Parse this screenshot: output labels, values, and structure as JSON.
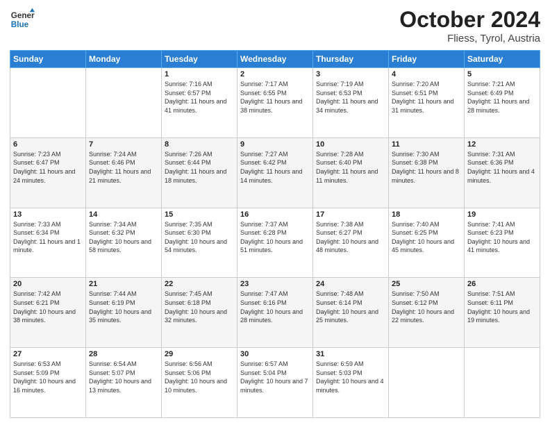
{
  "header": {
    "logo": {
      "general": "General",
      "blue": "Blue"
    },
    "title": "October 2024",
    "location": "Fliess, Tyrol, Austria"
  },
  "days": [
    "Sunday",
    "Monday",
    "Tuesday",
    "Wednesday",
    "Thursday",
    "Friday",
    "Saturday"
  ],
  "weeks": [
    [
      null,
      null,
      {
        "day": "1",
        "sunrise": "Sunrise: 7:16 AM",
        "sunset": "Sunset: 6:57 PM",
        "daylight": "Daylight: 11 hours and 41 minutes."
      },
      {
        "day": "2",
        "sunrise": "Sunrise: 7:17 AM",
        "sunset": "Sunset: 6:55 PM",
        "daylight": "Daylight: 11 hours and 38 minutes."
      },
      {
        "day": "3",
        "sunrise": "Sunrise: 7:19 AM",
        "sunset": "Sunset: 6:53 PM",
        "daylight": "Daylight: 11 hours and 34 minutes."
      },
      {
        "day": "4",
        "sunrise": "Sunrise: 7:20 AM",
        "sunset": "Sunset: 6:51 PM",
        "daylight": "Daylight: 11 hours and 31 minutes."
      },
      {
        "day": "5",
        "sunrise": "Sunrise: 7:21 AM",
        "sunset": "Sunset: 6:49 PM",
        "daylight": "Daylight: 11 hours and 28 minutes."
      }
    ],
    [
      {
        "day": "6",
        "sunrise": "Sunrise: 7:23 AM",
        "sunset": "Sunset: 6:47 PM",
        "daylight": "Daylight: 11 hours and 24 minutes."
      },
      {
        "day": "7",
        "sunrise": "Sunrise: 7:24 AM",
        "sunset": "Sunset: 6:46 PM",
        "daylight": "Daylight: 11 hours and 21 minutes."
      },
      {
        "day": "8",
        "sunrise": "Sunrise: 7:26 AM",
        "sunset": "Sunset: 6:44 PM",
        "daylight": "Daylight: 11 hours and 18 minutes."
      },
      {
        "day": "9",
        "sunrise": "Sunrise: 7:27 AM",
        "sunset": "Sunset: 6:42 PM",
        "daylight": "Daylight: 11 hours and 14 minutes."
      },
      {
        "day": "10",
        "sunrise": "Sunrise: 7:28 AM",
        "sunset": "Sunset: 6:40 PM",
        "daylight": "Daylight: 11 hours and 11 minutes."
      },
      {
        "day": "11",
        "sunrise": "Sunrise: 7:30 AM",
        "sunset": "Sunset: 6:38 PM",
        "daylight": "Daylight: 11 hours and 8 minutes."
      },
      {
        "day": "12",
        "sunrise": "Sunrise: 7:31 AM",
        "sunset": "Sunset: 6:36 PM",
        "daylight": "Daylight: 11 hours and 4 minutes."
      }
    ],
    [
      {
        "day": "13",
        "sunrise": "Sunrise: 7:33 AM",
        "sunset": "Sunset: 6:34 PM",
        "daylight": "Daylight: 11 hours and 1 minute."
      },
      {
        "day": "14",
        "sunrise": "Sunrise: 7:34 AM",
        "sunset": "Sunset: 6:32 PM",
        "daylight": "Daylight: 10 hours and 58 minutes."
      },
      {
        "day": "15",
        "sunrise": "Sunrise: 7:35 AM",
        "sunset": "Sunset: 6:30 PM",
        "daylight": "Daylight: 10 hours and 54 minutes."
      },
      {
        "day": "16",
        "sunrise": "Sunrise: 7:37 AM",
        "sunset": "Sunset: 6:28 PM",
        "daylight": "Daylight: 10 hours and 51 minutes."
      },
      {
        "day": "17",
        "sunrise": "Sunrise: 7:38 AM",
        "sunset": "Sunset: 6:27 PM",
        "daylight": "Daylight: 10 hours and 48 minutes."
      },
      {
        "day": "18",
        "sunrise": "Sunrise: 7:40 AM",
        "sunset": "Sunset: 6:25 PM",
        "daylight": "Daylight: 10 hours and 45 minutes."
      },
      {
        "day": "19",
        "sunrise": "Sunrise: 7:41 AM",
        "sunset": "Sunset: 6:23 PM",
        "daylight": "Daylight: 10 hours and 41 minutes."
      }
    ],
    [
      {
        "day": "20",
        "sunrise": "Sunrise: 7:42 AM",
        "sunset": "Sunset: 6:21 PM",
        "daylight": "Daylight: 10 hours and 38 minutes."
      },
      {
        "day": "21",
        "sunrise": "Sunrise: 7:44 AM",
        "sunset": "Sunset: 6:19 PM",
        "daylight": "Daylight: 10 hours and 35 minutes."
      },
      {
        "day": "22",
        "sunrise": "Sunrise: 7:45 AM",
        "sunset": "Sunset: 6:18 PM",
        "daylight": "Daylight: 10 hours and 32 minutes."
      },
      {
        "day": "23",
        "sunrise": "Sunrise: 7:47 AM",
        "sunset": "Sunset: 6:16 PM",
        "daylight": "Daylight: 10 hours and 28 minutes."
      },
      {
        "day": "24",
        "sunrise": "Sunrise: 7:48 AM",
        "sunset": "Sunset: 6:14 PM",
        "daylight": "Daylight: 10 hours and 25 minutes."
      },
      {
        "day": "25",
        "sunrise": "Sunrise: 7:50 AM",
        "sunset": "Sunset: 6:12 PM",
        "daylight": "Daylight: 10 hours and 22 minutes."
      },
      {
        "day": "26",
        "sunrise": "Sunrise: 7:51 AM",
        "sunset": "Sunset: 6:11 PM",
        "daylight": "Daylight: 10 hours and 19 minutes."
      }
    ],
    [
      {
        "day": "27",
        "sunrise": "Sunrise: 6:53 AM",
        "sunset": "Sunset: 5:09 PM",
        "daylight": "Daylight: 10 hours and 16 minutes."
      },
      {
        "day": "28",
        "sunrise": "Sunrise: 6:54 AM",
        "sunset": "Sunset: 5:07 PM",
        "daylight": "Daylight: 10 hours and 13 minutes."
      },
      {
        "day": "29",
        "sunrise": "Sunrise: 6:56 AM",
        "sunset": "Sunset: 5:06 PM",
        "daylight": "Daylight: 10 hours and 10 minutes."
      },
      {
        "day": "30",
        "sunrise": "Sunrise: 6:57 AM",
        "sunset": "Sunset: 5:04 PM",
        "daylight": "Daylight: 10 hours and 7 minutes."
      },
      {
        "day": "31",
        "sunrise": "Sunrise: 6:59 AM",
        "sunset": "Sunset: 5:03 PM",
        "daylight": "Daylight: 10 hours and 4 minutes."
      },
      null,
      null
    ]
  ]
}
